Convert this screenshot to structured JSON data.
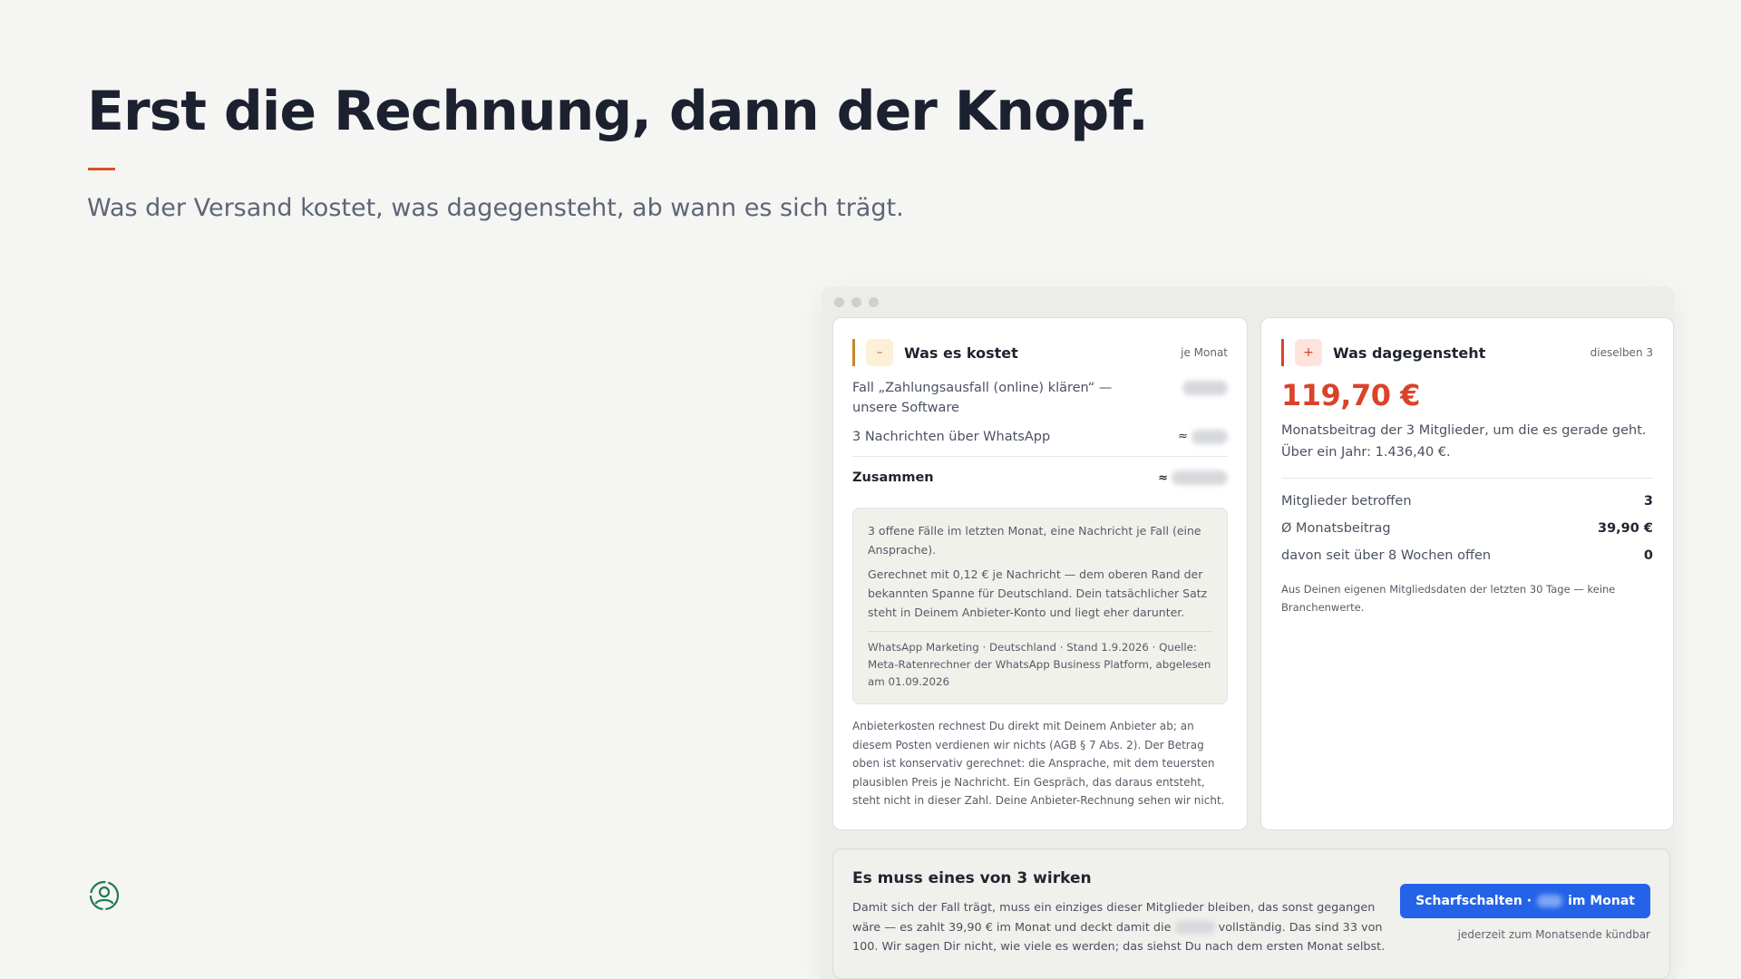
{
  "slide": {
    "headline": "Erst die Rechnung, dann der Knopf.",
    "subline": "Was der Versand kostet, was dagegensteht, ab wann es sich trägt.",
    "brand_icon": "user-circle-icon",
    "accent_color": "#d9532c"
  },
  "cost_card": {
    "badge": "–",
    "title": "Was es kostet",
    "meta": "je Monat",
    "items": [
      {
        "label": "Fall „Zahlungsausfall (online) klären“ — unsere Software",
        "prefix": ""
      },
      {
        "label": "3 Nachrichten über WhatsApp",
        "prefix": "≈"
      }
    ],
    "total_label": "Zusammen",
    "total_prefix": "≈",
    "info": {
      "p1": "3 offene Fälle im letzten Monat, eine Nachricht je Fall (eine Ansprache).",
      "p2": "Gerechnet mit 0,12 € je Nachricht — dem oberen Rand der bekannten Spanne für Deutschland. Dein tatsächlicher Satz steht in Deinem Anbieter-Konto und liegt eher darunter.",
      "source": "WhatsApp Marketing · Deutschland · Stand 1.9.2026 · Quelle: Meta-Ratenrechner der WhatsApp Business Platform, abgelesen am 01.09.2026"
    },
    "fineprint": "Anbieterkosten rechnest Du direkt mit Deinem Anbieter ab; an diesem Posten verdienen wir nichts (AGB § 7 Abs. 2). Der Betrag oben ist konservativ gerechnet: die Ansprache, mit dem teuersten plausiblen Preis je Nachricht. Ein Gespräch, das daraus entsteht, steht nicht in dieser Zahl. Deine Anbieter-Rechnung sehen wir nicht.",
    "accent_color": "#c8862a"
  },
  "value_card": {
    "badge": "+",
    "title": "Was dagegensteht",
    "meta": "dieselben 3",
    "amount": "119,70 €",
    "desc": "Monatsbeitrag der 3 Mitglieder, um die es gerade geht. Über ein Jahr: 1.436,40 €.",
    "stats": [
      {
        "label": "Mitglieder betroffen",
        "value": "3"
      },
      {
        "label": "Ø Monatsbeitrag",
        "value": "39,90 €"
      },
      {
        "label": "davon seit über 8 Wochen offen",
        "value": "0"
      }
    ],
    "note": "Aus Deinen eigenen Mitgliedsdaten der letzten 30 Tage — keine Branchenwerte.",
    "accent_color": "#d9432a"
  },
  "cta": {
    "title": "Es muss eines von 3 wirken",
    "text_before": "Damit sich der Fall trägt, muss ein einziges dieser Mitglieder bleiben, das sonst gegangen wäre — es zahlt 39,90 € im Monat und deckt damit die",
    "text_after": "vollständig. Das sind 33 von 100. Wir sagen Dir nicht, wie viele es werden; das siehst Du nach dem ersten Monat selbst.",
    "button_prefix": "Scharfschalten ·",
    "button_suffix": "im Monat",
    "sub": "jederzeit zum Monatsende kündbar",
    "button_color": "#2463e8"
  }
}
